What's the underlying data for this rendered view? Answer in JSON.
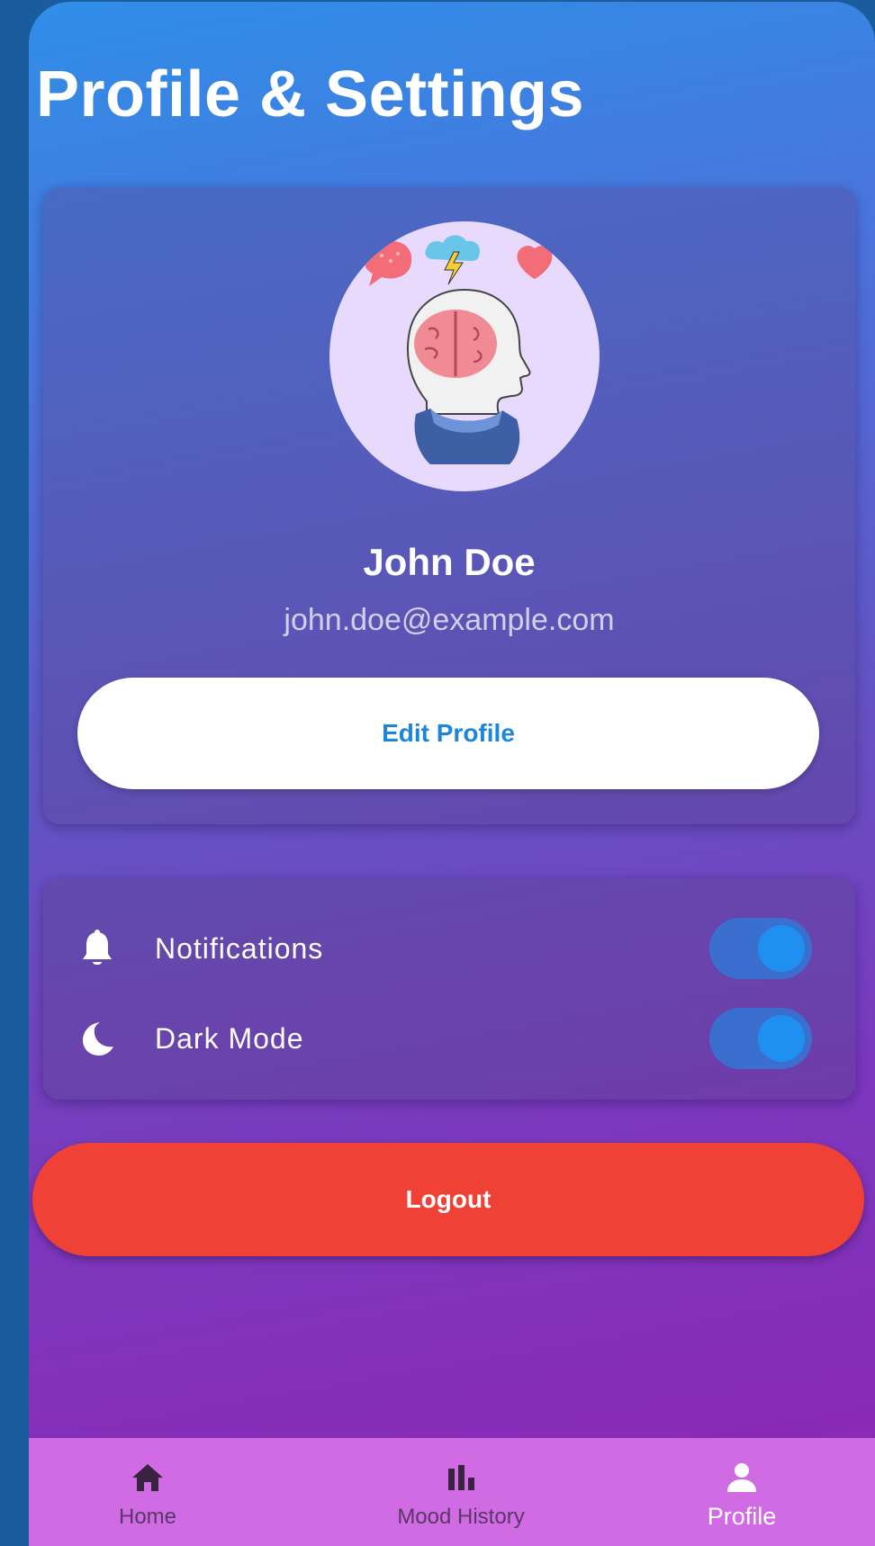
{
  "header": {
    "title": "Profile & Settings"
  },
  "profile": {
    "avatar_icon": "brain-head-icon",
    "name": "John Doe",
    "email": "john.doe@example.com",
    "edit_label": "Edit Profile"
  },
  "settings": {
    "items": [
      {
        "icon": "bell-icon",
        "label": "Notifications",
        "enabled": true
      },
      {
        "icon": "moon-icon",
        "label": "Dark Mode",
        "enabled": true
      }
    ]
  },
  "logout": {
    "label": "Logout",
    "color": "#ef4135"
  },
  "bottom_nav": {
    "items": [
      {
        "icon": "home-icon",
        "label": "Home",
        "active": false
      },
      {
        "icon": "bar-chart-icon",
        "label": "Mood History",
        "active": false
      },
      {
        "icon": "person-icon",
        "label": "Profile",
        "active": true
      }
    ]
  },
  "colors": {
    "accent": "#1f8ff0",
    "nav_background": "#d16be4",
    "danger": "#ef4135"
  }
}
